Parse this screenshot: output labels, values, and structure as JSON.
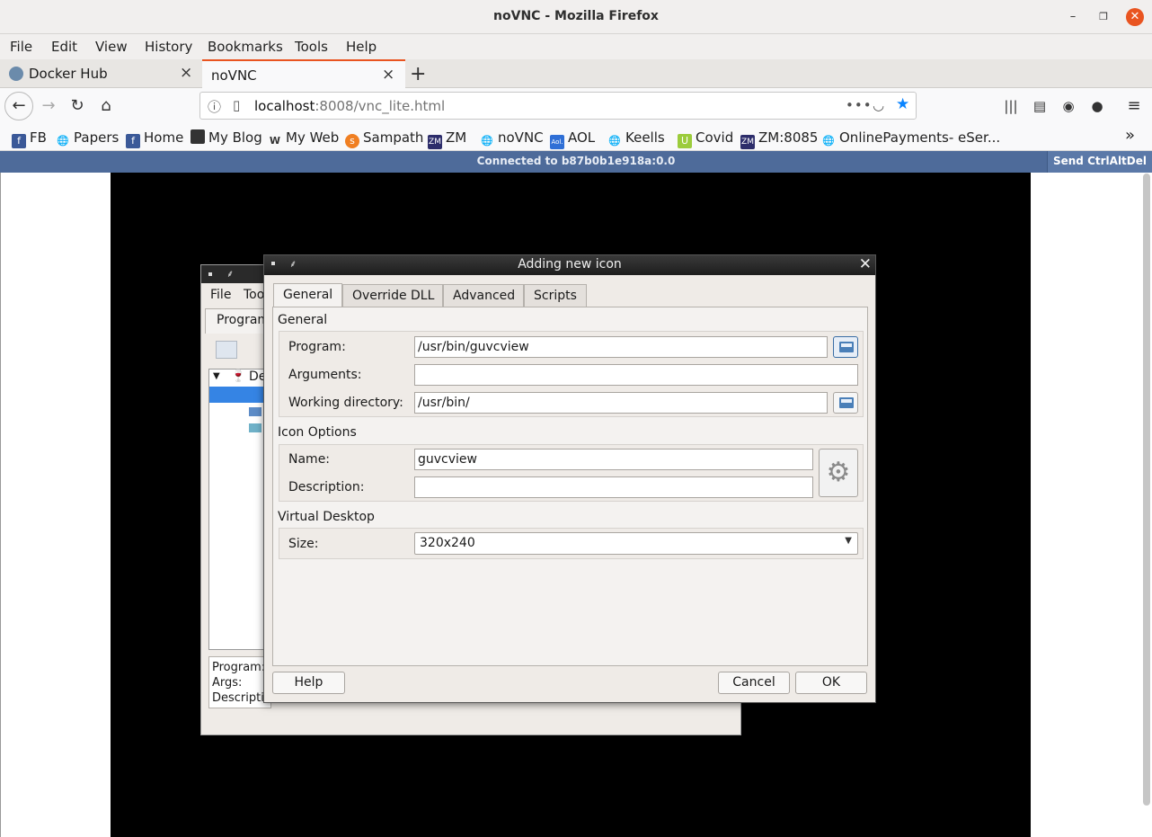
{
  "window": {
    "title": "noVNC - Mozilla Firefox"
  },
  "menu": [
    "File",
    "Edit",
    "View",
    "History",
    "Bookmarks",
    "Tools",
    "Help"
  ],
  "tabs": [
    {
      "label": "Docker Hub",
      "active": false
    },
    {
      "label": "noVNC",
      "active": true
    }
  ],
  "url": {
    "host": "localhost",
    "rest": ":8008/vnc_lite.html"
  },
  "bookmarks": [
    {
      "label": "FB",
      "icon": "facebook-icon"
    },
    {
      "label": "Papers",
      "icon": "globe-icon"
    },
    {
      "label": "Home",
      "icon": "facebook-icon"
    },
    {
      "label": "My Blog",
      "icon": "blog-icon"
    },
    {
      "label": "My Web",
      "icon": "w-icon"
    },
    {
      "label": "Sampath",
      "icon": "sampath-icon"
    },
    {
      "label": "ZM",
      "icon": "zm-icon"
    },
    {
      "label": "noVNC",
      "icon": "globe-icon"
    },
    {
      "label": "AOL",
      "icon": "aol-icon"
    },
    {
      "label": "Keells",
      "icon": "globe-icon"
    },
    {
      "label": "Covid",
      "icon": "covid-icon"
    },
    {
      "label": "ZM:8085",
      "icon": "zm-icon"
    },
    {
      "label": "OnlinePayments- eSer...",
      "icon": "globe-icon"
    }
  ],
  "vnc": {
    "status": "Connected to b87b0b1e918a:0.0",
    "send_cad": "Send CtrlAltDel"
  },
  "bgwin": {
    "menu": [
      "File",
      "Too"
    ],
    "tab": "Program",
    "tree_item": "De",
    "info": [
      "Program:",
      "Args:",
      "Descripti"
    ]
  },
  "dialog": {
    "title": "Adding new icon",
    "tabs": [
      "General",
      "Override DLL",
      "Advanced",
      "Scripts"
    ],
    "general": {
      "section": "General",
      "program_label": "Program:",
      "program_value": "/usr/bin/guvcview",
      "arguments_label": "Arguments:",
      "arguments_value": "",
      "workdir_label": "Working directory:",
      "workdir_value": "/usr/bin/"
    },
    "icon_options": {
      "section": "Icon Options",
      "name_label": "Name:",
      "name_value": "guvcview",
      "description_label": "Description:",
      "description_value": ""
    },
    "virtual_desktop": {
      "section": "Virtual Desktop",
      "size_label": "Size:",
      "size_value": "320x240"
    },
    "buttons": {
      "help": "Help",
      "cancel": "Cancel",
      "ok": "OK"
    }
  },
  "colors": {
    "accent": "#e95420",
    "vnc_bar": "#4e6b9a",
    "selection": "#3584e4"
  }
}
